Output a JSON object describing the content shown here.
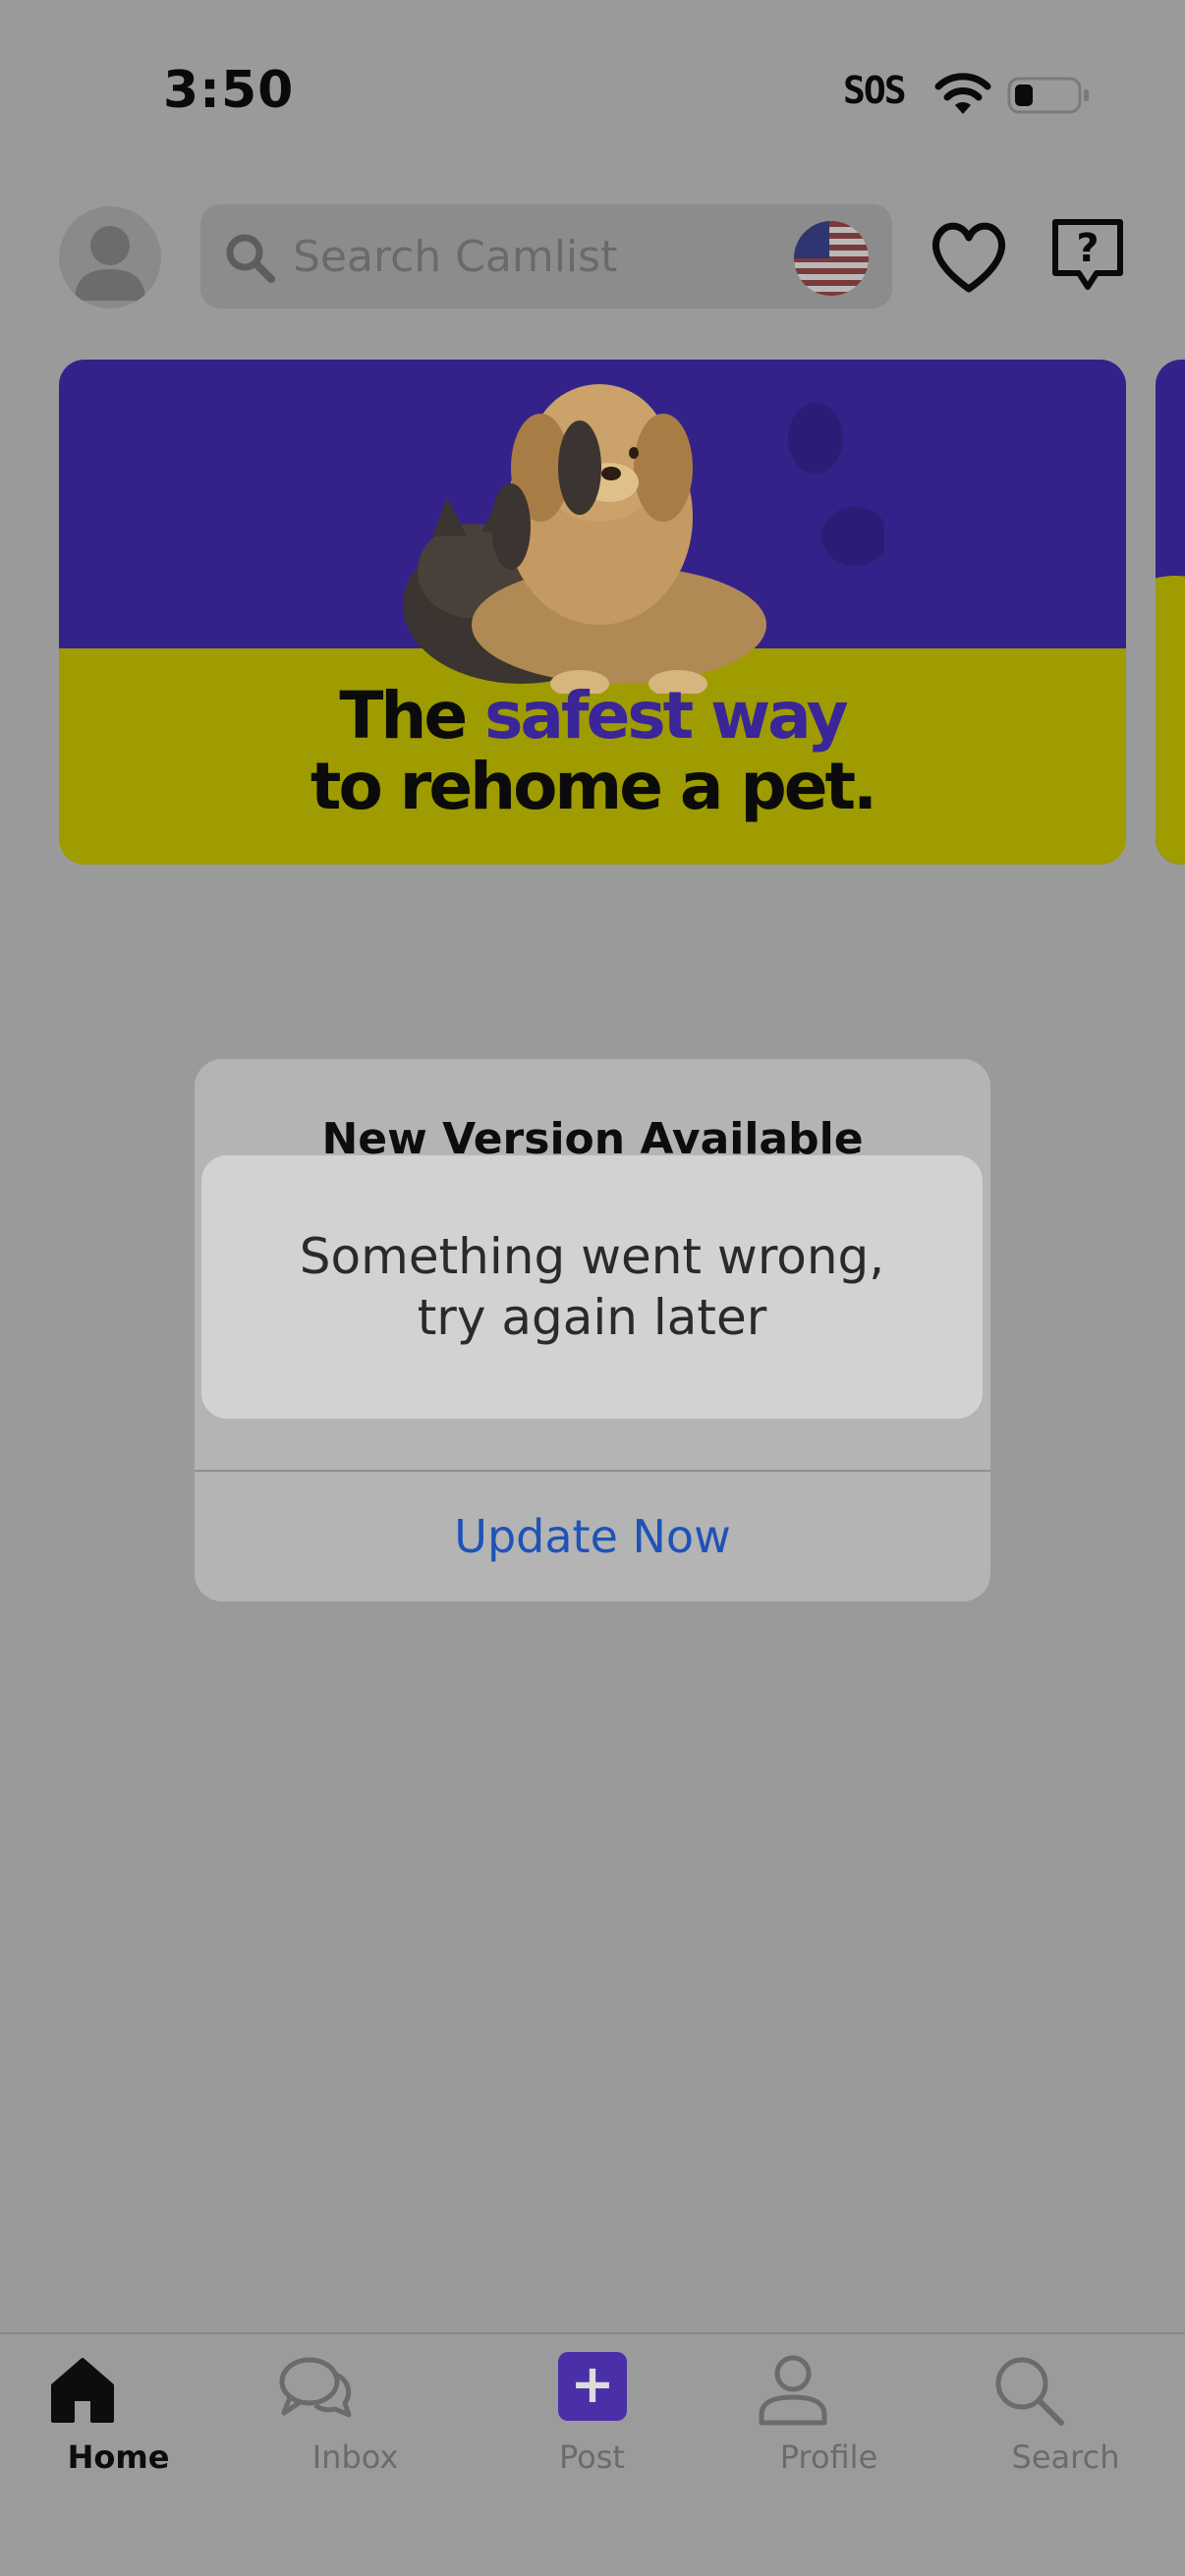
{
  "status_bar": {
    "time": "3:50",
    "sos": "SOS"
  },
  "header": {
    "search": {
      "placeholder": "Search Camlist"
    },
    "icons": [
      "avatar",
      "search-icon",
      "us-flag-icon",
      "heart-icon",
      "help-chat-icon"
    ]
  },
  "banner": {
    "line1_part1": "The ",
    "line1_accent": "safest way",
    "line2": "to rehome a pet."
  },
  "alert": {
    "title": "New Version Available",
    "button": "Update Now"
  },
  "toast": {
    "message": "Something went wrong, try again later"
  },
  "tab_bar": {
    "tabs": [
      {
        "label": "Home",
        "icon": "home-icon",
        "active": true
      },
      {
        "label": "Inbox",
        "icon": "chat-bubbles-icon",
        "active": false
      },
      {
        "label": "Post",
        "icon": "plus-icon",
        "active": false
      },
      {
        "label": "Profile",
        "icon": "person-icon",
        "active": false
      },
      {
        "label": "Search",
        "icon": "search-icon",
        "active": false
      }
    ]
  },
  "colors": {
    "overlay_background": "#9a9a9a",
    "brand_purple": "#4a2fa8",
    "banner_yellow": "#9e9c00",
    "link_blue": "#1e53b7"
  }
}
